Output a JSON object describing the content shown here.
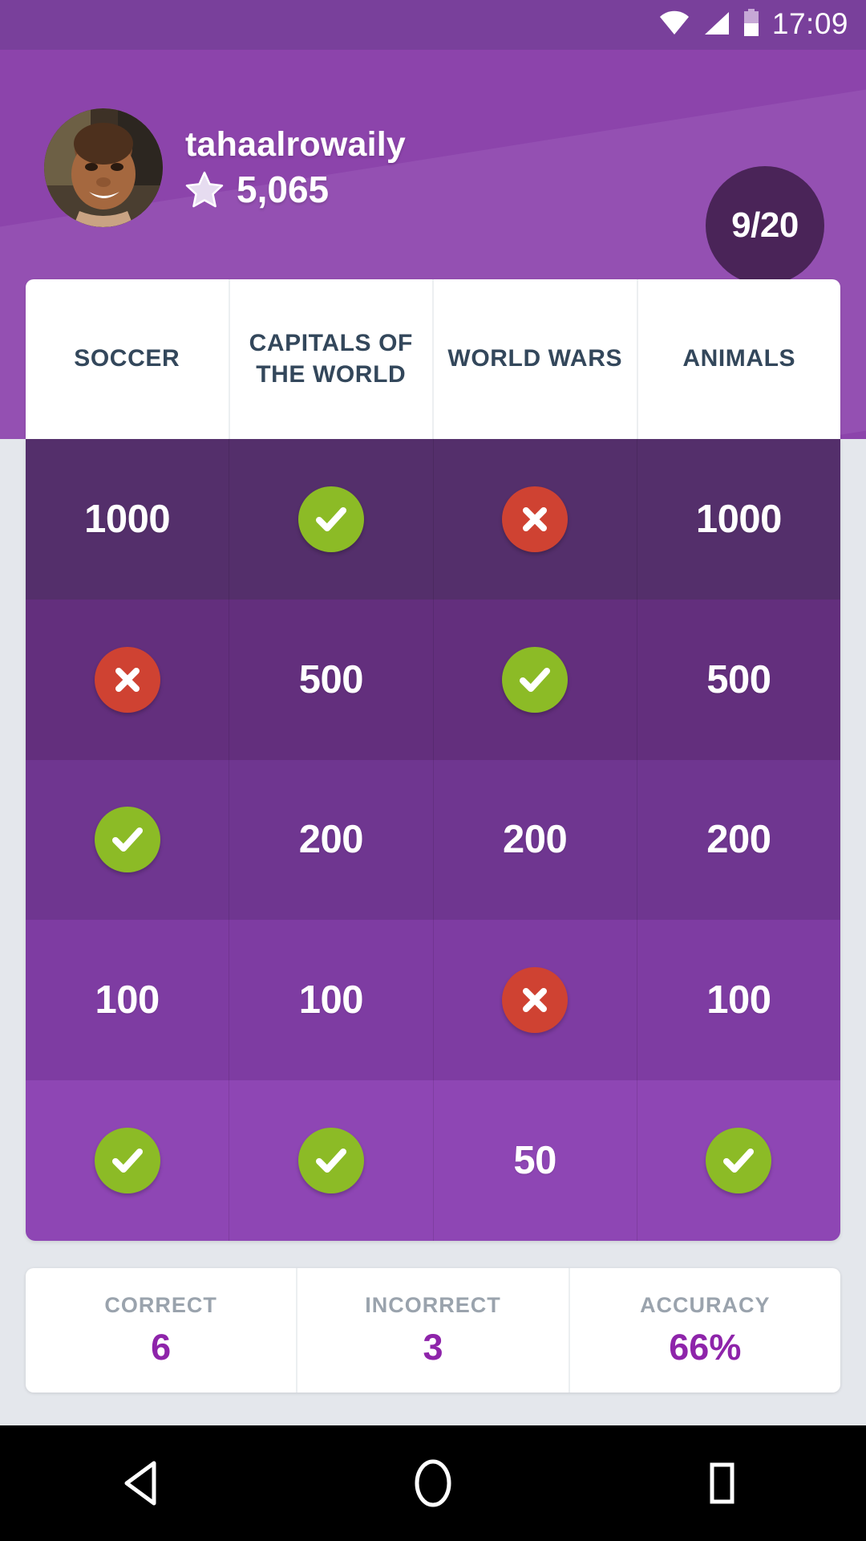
{
  "status_bar": {
    "wifi_icon": "wifi-icon",
    "signal_icon": "cellular-signal-icon",
    "battery_icon": "battery-icon",
    "time": "17:09"
  },
  "header": {
    "avatar_icon": "user-avatar-photo",
    "username": "tahaalrowaily",
    "star_icon": "star-icon",
    "points": "5,065",
    "score_badge": "9/20",
    "background_color": "#8c44ab",
    "badge_color": "#4a2458"
  },
  "categories": [
    {
      "label": "SOCCER"
    },
    {
      "label": "CAPITALS OF THE WORLD"
    },
    {
      "label": "WORLD WARS"
    },
    {
      "label": "ANIMALS"
    }
  ],
  "grid": {
    "row_colors": [
      "#542f6b",
      "#632f7d",
      "#6f3690",
      "#7e3ca2",
      "#8e46b4"
    ],
    "correct_color": "#8cbb26",
    "incorrect_color": "#cf4232",
    "rows": [
      {
        "points": "1000",
        "cells": [
          {
            "type": "value",
            "text": "1000"
          },
          {
            "type": "correct",
            "text": ""
          },
          {
            "type": "incorrect",
            "text": ""
          },
          {
            "type": "value",
            "text": "1000"
          }
        ]
      },
      {
        "points": "500",
        "cells": [
          {
            "type": "incorrect",
            "text": ""
          },
          {
            "type": "value",
            "text": "500"
          },
          {
            "type": "correct",
            "text": ""
          },
          {
            "type": "value",
            "text": "500"
          }
        ]
      },
      {
        "points": "200",
        "cells": [
          {
            "type": "correct",
            "text": ""
          },
          {
            "type": "value",
            "text": "200"
          },
          {
            "type": "value",
            "text": "200"
          },
          {
            "type": "value",
            "text": "200"
          }
        ]
      },
      {
        "points": "100",
        "cells": [
          {
            "type": "value",
            "text": "100"
          },
          {
            "type": "value",
            "text": "100"
          },
          {
            "type": "incorrect",
            "text": ""
          },
          {
            "type": "value",
            "text": "100"
          }
        ]
      },
      {
        "points": "50",
        "cells": [
          {
            "type": "correct",
            "text": ""
          },
          {
            "type": "correct",
            "text": ""
          },
          {
            "type": "value",
            "text": "50"
          },
          {
            "type": "correct",
            "text": ""
          }
        ]
      }
    ]
  },
  "stats": [
    {
      "label": "CORRECT",
      "value": "6"
    },
    {
      "label": "INCORRECT",
      "value": "3"
    },
    {
      "label": "ACCURACY",
      "value": "66%"
    }
  ],
  "stats_accent_color": "#8e24aa",
  "nav_bar": {
    "back_icon": "back-triangle-icon",
    "home_icon": "home-circle-icon",
    "recents_icon": "recents-square-icon"
  }
}
